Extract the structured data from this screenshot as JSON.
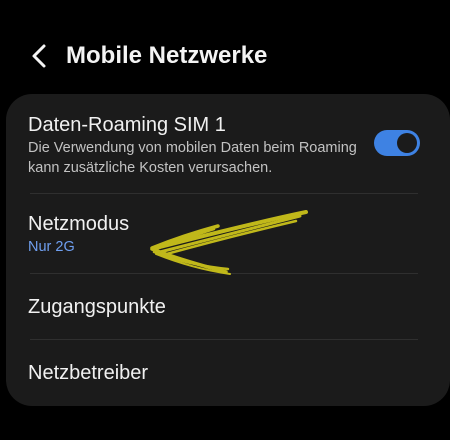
{
  "header": {
    "back_icon": "chevron-left-icon",
    "title": "Mobile Netzwerke"
  },
  "settings": {
    "data_roaming": {
      "title": "Daten-Roaming SIM 1",
      "description": "Die Verwendung von mobilen Daten beim Roaming kann zusätzliche Kosten verursachen.",
      "toggle_on": true
    },
    "network_mode": {
      "title": "Netzmodus",
      "value": "Nur 2G"
    },
    "access_points": {
      "title": "Zugangspunkte"
    },
    "network_operators": {
      "title": "Netzbetreiber"
    }
  },
  "annotation": {
    "type": "hand-drawn-arrow",
    "pointing_at": "network_mode"
  },
  "colors": {
    "background": "#000000",
    "card": "#1b1b1b",
    "accent_blue": "#3e82e3",
    "value_blue": "#6f9ff0",
    "annotation_yellow": "#c9c11a"
  }
}
